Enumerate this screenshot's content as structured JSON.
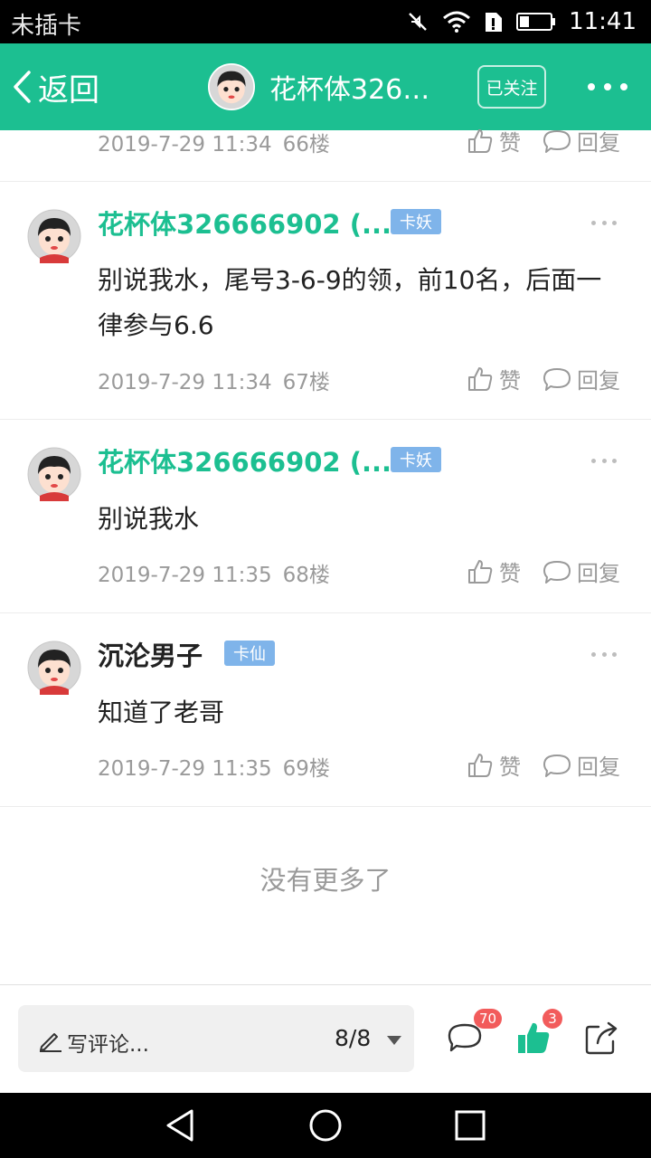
{
  "status_bar": {
    "carrier": "未插卡",
    "time": "11:41",
    "icons": [
      "mute-icon",
      "wifi-icon",
      "sim-alert-icon",
      "battery-icon"
    ]
  },
  "header": {
    "back_label": "返回",
    "title": "花杯体326666902 (...",
    "follow_label": "已关注",
    "more_icon": "more-dots-icon"
  },
  "partial_post": {
    "date": "2019-7-29 11:34",
    "floor": "66楼",
    "like_label": "赞",
    "reply_label": "回复"
  },
  "posts": [
    {
      "author": "花杯体326666902 (...",
      "badge": "卡妖",
      "content": "别说我水，尾号3-6-9的领，前10名，后面一律参与6.6",
      "date": "2019-7-29 11:34",
      "floor": "67楼",
      "like_label": "赞",
      "reply_label": "回复"
    },
    {
      "author": "花杯体326666902 (...",
      "badge": "卡妖",
      "content": "别说我水",
      "date": "2019-7-29 11:35",
      "floor": "68楼",
      "like_label": "赞",
      "reply_label": "回复"
    },
    {
      "author": "沉沦男子",
      "badge": "卡仙",
      "content": "知道了老哥",
      "date": "2019-7-29 11:35",
      "floor": "69楼",
      "like_label": "赞",
      "reply_label": "回复"
    }
  ],
  "end_text": "没有更多了",
  "bottom_bar": {
    "comment_placeholder": "写评论...",
    "page_indicator": "8/8",
    "comment_count": "70",
    "like_count": "3"
  },
  "colors": {
    "brand": "#1cbf91",
    "badge": "#7fb4ea",
    "count_badge": "#f25b5b"
  }
}
